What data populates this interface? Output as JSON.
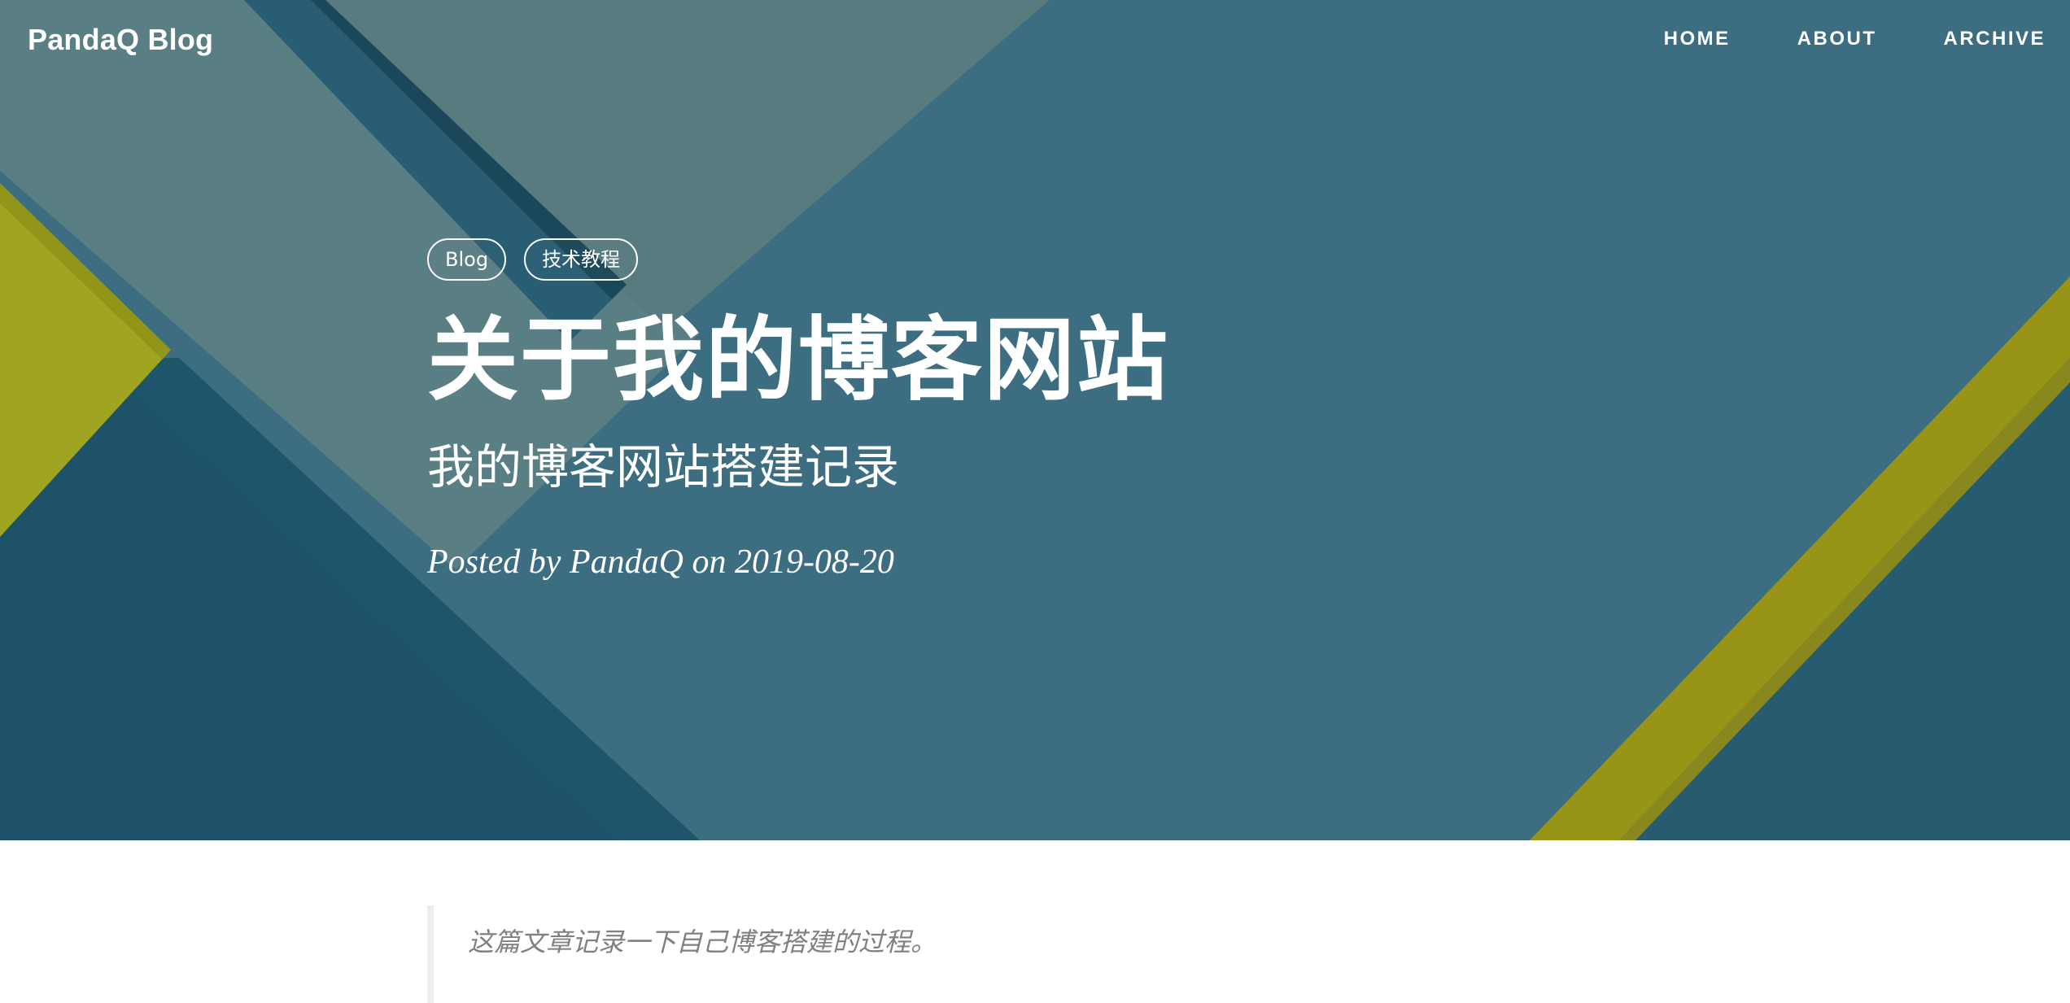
{
  "navbar": {
    "brand": "PandaQ Blog",
    "links": [
      {
        "label": "HOME"
      },
      {
        "label": "ABOUT"
      },
      {
        "label": "ARCHIVE"
      }
    ]
  },
  "post": {
    "tags": [
      "Blog",
      "技术教程"
    ],
    "title": "关于我的博客网站",
    "subtitle": "我的博客网站搭建记录",
    "meta": "Posted by PandaQ on 2019-08-20"
  },
  "content": {
    "intro_quote": "这篇文章记录一下自己博客搭建的过程。"
  },
  "colors": {
    "hero_base": "#3f7287",
    "hero_dark": "#1d5169",
    "hero_light": "#5c8388",
    "accent_yellow": "#a6a419",
    "text_white": "#ffffff",
    "quote_text": "#808080"
  }
}
